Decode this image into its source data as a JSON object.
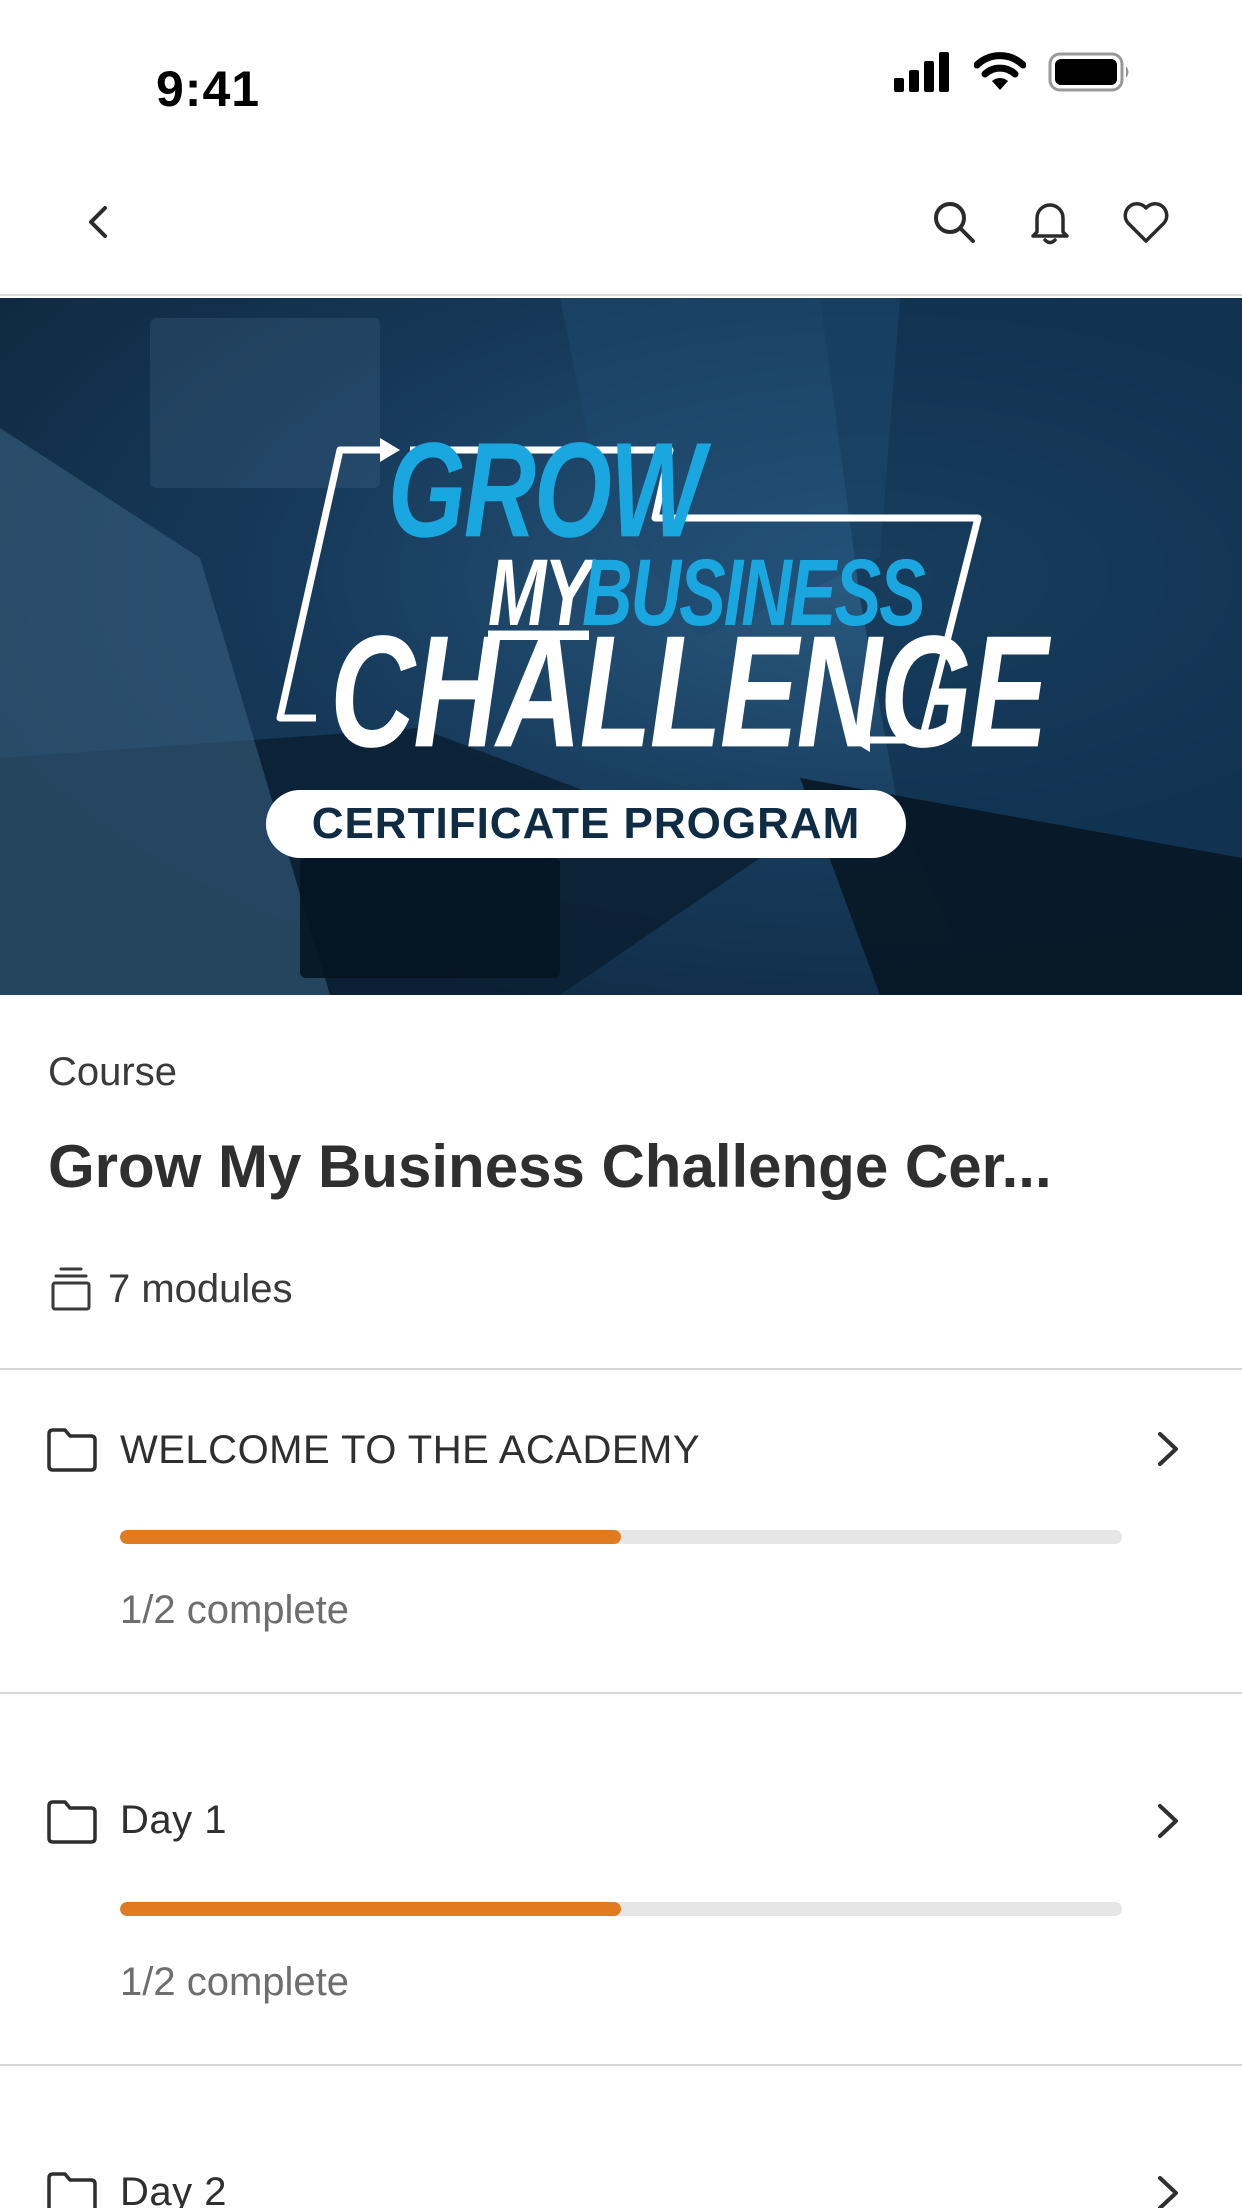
{
  "status_bar": {
    "time": "9:41"
  },
  "nav": {
    "back_icon": "chevron-left-icon",
    "actions": [
      "search-icon",
      "bell-icon",
      "heart-icon"
    ]
  },
  "hero": {
    "logo_line1": "GROW",
    "logo_line2a": "MY",
    "logo_line2b": "BUSINESS",
    "logo_line3": "CHALLENGE",
    "logo_pill": "CERTIFICATE PROGRAM",
    "colors": {
      "brand_blue": "#1aa7e0",
      "navy": "#0f2c44"
    }
  },
  "course": {
    "kind": "Course",
    "title": "Grow My Business Challenge Cer...",
    "modules_count_label": "7 modules"
  },
  "modules": [
    {
      "title": "WELCOME TO THE ACADEMY",
      "progress": 0.5,
      "status": "1/2 complete"
    },
    {
      "title": "Day 1",
      "progress": 0.5,
      "status": "1/2 complete"
    },
    {
      "title": "Day 2"
    }
  ],
  "colors": {
    "accent_progress": "#e07b22",
    "track": "#e6e6e6"
  }
}
